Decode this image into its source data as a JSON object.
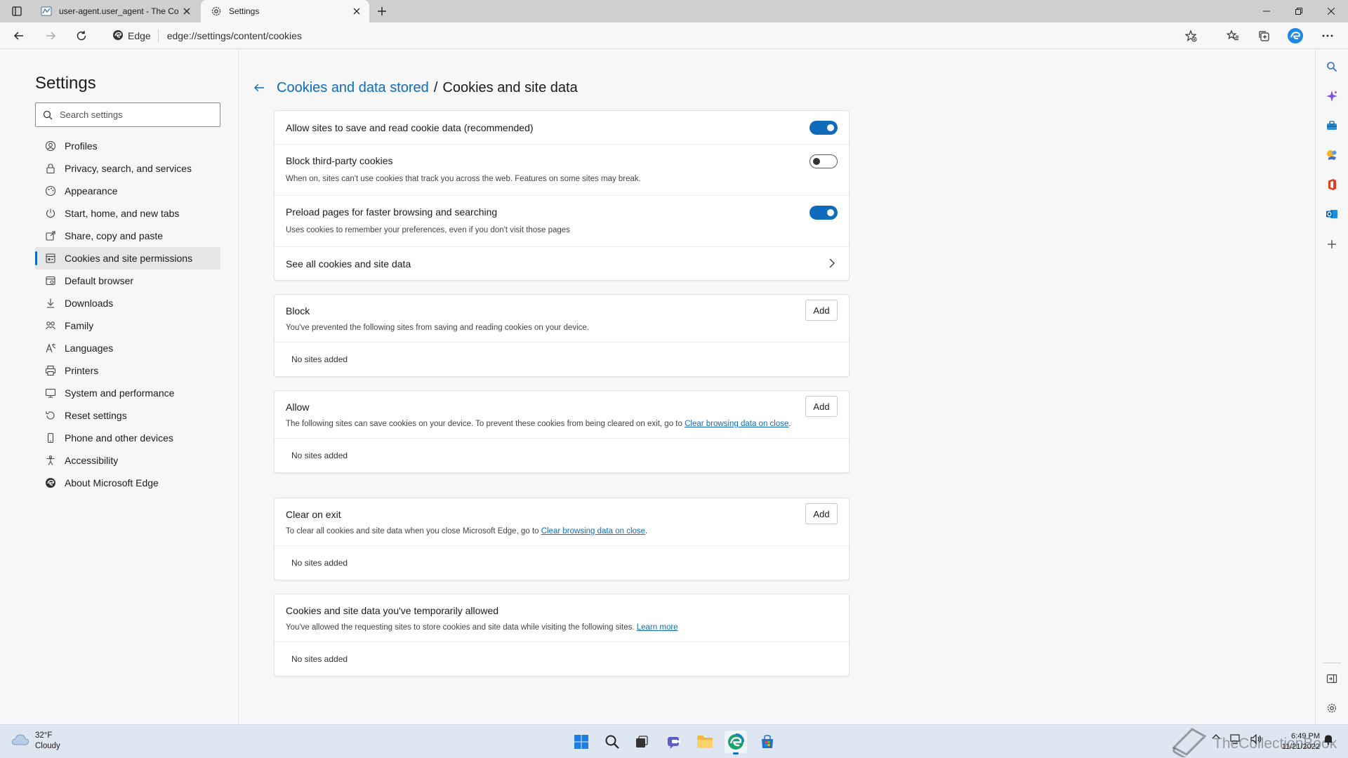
{
  "tabs": [
    {
      "title": "user-agent.user_agent - The Coll",
      "active": false
    },
    {
      "title": "Settings",
      "active": true
    }
  ],
  "address": {
    "site_label": "Edge",
    "url": "edge://settings/content/cookies"
  },
  "nav": {
    "title": "Settings",
    "search_placeholder": "Search settings",
    "items": [
      {
        "label": "Profiles",
        "icon": "profile-icon"
      },
      {
        "label": "Privacy, search, and services",
        "icon": "lock-icon"
      },
      {
        "label": "Appearance",
        "icon": "appearance-icon"
      },
      {
        "label": "Start, home, and new tabs",
        "icon": "power-icon"
      },
      {
        "label": "Share, copy and paste",
        "icon": "share-icon"
      },
      {
        "label": "Cookies and site permissions",
        "icon": "cookies-icon",
        "active": true
      },
      {
        "label": "Default browser",
        "icon": "browser-icon"
      },
      {
        "label": "Downloads",
        "icon": "download-icon"
      },
      {
        "label": "Family",
        "icon": "family-icon"
      },
      {
        "label": "Languages",
        "icon": "language-icon"
      },
      {
        "label": "Printers",
        "icon": "printer-icon"
      },
      {
        "label": "System and performance",
        "icon": "system-icon"
      },
      {
        "label": "Reset settings",
        "icon": "reset-icon"
      },
      {
        "label": "Phone and other devices",
        "icon": "phone-icon"
      },
      {
        "label": "Accessibility",
        "icon": "accessibility-icon"
      },
      {
        "label": "About Microsoft Edge",
        "icon": "edge-icon"
      }
    ]
  },
  "header": {
    "crumb_link": "Cookies and data stored",
    "separator": "/",
    "current": "Cookies and site data"
  },
  "settings_card": {
    "allow_cookies": {
      "title": "Allow sites to save and read cookie data (recommended)",
      "on": true
    },
    "block_third_party": {
      "title": "Block third-party cookies",
      "desc": "When on, sites can't use cookies that track you across the web. Features on some sites may break.",
      "on": false
    },
    "preload": {
      "title": "Preload pages for faster browsing and searching",
      "desc": "Uses cookies to remember your preferences, even if you don't visit those pages",
      "on": true
    },
    "see_all": {
      "title": "See all cookies and site data"
    }
  },
  "block": {
    "title": "Block",
    "desc": "You've prevented the following sites from saving and reading cookies on your device.",
    "add_label": "Add",
    "empty": "No sites added"
  },
  "allow": {
    "title": "Allow",
    "desc": "The following sites can save cookies on your device. To prevent these cookies from being cleared on exit, go to ",
    "link": "Clear browsing data on close",
    "desc_end": ".",
    "add_label": "Add",
    "empty": "No sites added"
  },
  "clear_on_exit": {
    "title": "Clear on exit",
    "desc": "To clear all cookies and site data when you close Microsoft Edge, go to ",
    "link": "Clear browsing data on close",
    "desc_end": ".",
    "add_label": "Add",
    "empty": "No sites added"
  },
  "temp_allowed": {
    "title": "Cookies and site data you've temporarily allowed",
    "desc": "You've allowed the requesting sites to store cookies and site data while visiting the following sites. ",
    "link": "Learn more",
    "empty": "No sites added"
  },
  "taskbar": {
    "weather_temp": "32°F",
    "weather_cond": "Cloudy",
    "time": "6:49 PM",
    "date": "11/21/2022",
    "watermark": "TheCollectionBook"
  },
  "colors": {
    "accent": "#0f6cbd",
    "toggle_off_border": "#5c5c5c"
  }
}
